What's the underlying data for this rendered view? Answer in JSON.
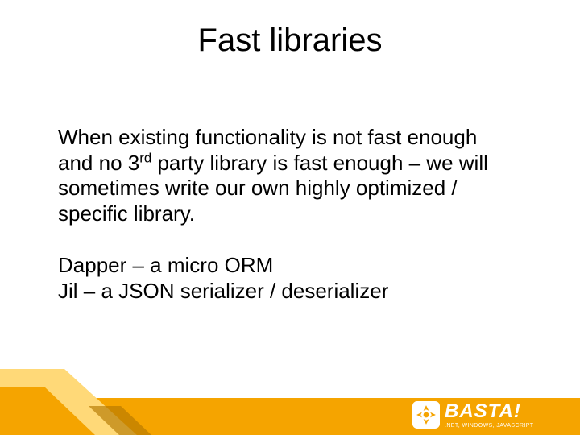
{
  "title": "Fast libraries",
  "paragraph1_pre": "When existing functionality is not fast enough and no 3",
  "paragraph1_sup": "rd",
  "paragraph1_post": " party library is fast enough – we will sometimes write our own highly optimized / specific library.",
  "list_line1": "Dapper – a micro ORM",
  "list_line2": "Jil – a JSON serializer / deserializer",
  "logo_name": "BASTA!",
  "logo_tagline": ".NET, WINDOWS, JAVASCRIPT",
  "colors": {
    "accent_orange": "#f5a400",
    "accent_light": "#ffd978",
    "accent_shadow": "#9e6d00"
  }
}
